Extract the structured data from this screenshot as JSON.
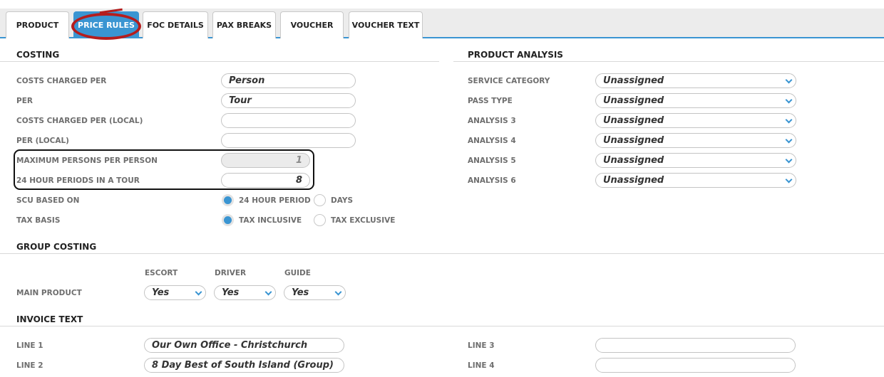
{
  "tabs": [
    "PRODUCT",
    "PRICE RULES",
    "FOC DETAILS",
    "PAX BREAKS",
    "VOUCHER",
    "VOUCHER TEXT"
  ],
  "active_tab": "PRICE RULES",
  "costing": {
    "title": "COSTING",
    "costs_charged_per": {
      "label": "COSTS CHARGED PER",
      "value": "Person"
    },
    "per": {
      "label": "PER",
      "value": "Tour"
    },
    "costs_charged_per_local": {
      "label": "COSTS CHARGED PER (LOCAL)",
      "value": ""
    },
    "per_local": {
      "label": "PER (LOCAL)",
      "value": ""
    },
    "max_persons": {
      "label": "MAXIMUM PERSONS PER PERSON",
      "value": "1"
    },
    "periods": {
      "label": "24 HOUR PERIODS IN A TOUR",
      "value": "8"
    },
    "scu_based_on": {
      "label": "SCU BASED ON",
      "options": [
        "24 HOUR PERIOD",
        "DAYS"
      ],
      "selected": "24 HOUR PERIOD"
    },
    "tax_basis": {
      "label": "TAX BASIS",
      "options": [
        "TAX INCLUSIVE",
        "TAX EXCLUSIVE"
      ],
      "selected": "TAX INCLUSIVE"
    }
  },
  "product_analysis": {
    "title": "PRODUCT ANALYSIS",
    "rows": [
      {
        "label": "SERVICE CATEGORY",
        "value": "Unassigned"
      },
      {
        "label": "PASS TYPE",
        "value": "Unassigned"
      },
      {
        "label": "ANALYSIS 3",
        "value": "Unassigned"
      },
      {
        "label": "ANALYSIS 4",
        "value": "Unassigned"
      },
      {
        "label": "ANALYSIS 5",
        "value": "Unassigned"
      },
      {
        "label": "ANALYSIS 6",
        "value": "Unassigned"
      }
    ]
  },
  "group_costing": {
    "title": "GROUP COSTING",
    "columns": [
      "ESCORT",
      "DRIVER",
      "GUIDE"
    ],
    "row_label": "MAIN PRODUCT",
    "values": [
      "Yes",
      "Yes",
      "Yes"
    ]
  },
  "invoice_text": {
    "title": "INVOICE TEXT",
    "line1": {
      "label": "LINE 1",
      "value": "Our Own Office - Christchurch"
    },
    "line2": {
      "label": "LINE 2",
      "value": "8 Day Best of South Island (Group)"
    },
    "line3": {
      "label": "LINE 3",
      "value": ""
    },
    "line4": {
      "label": "LINE 4",
      "value": ""
    }
  },
  "colors": {
    "accent": "#3a95d2",
    "annotation": "#b51d1d"
  },
  "icons": {
    "select_caret": "chevron-down-icon"
  }
}
